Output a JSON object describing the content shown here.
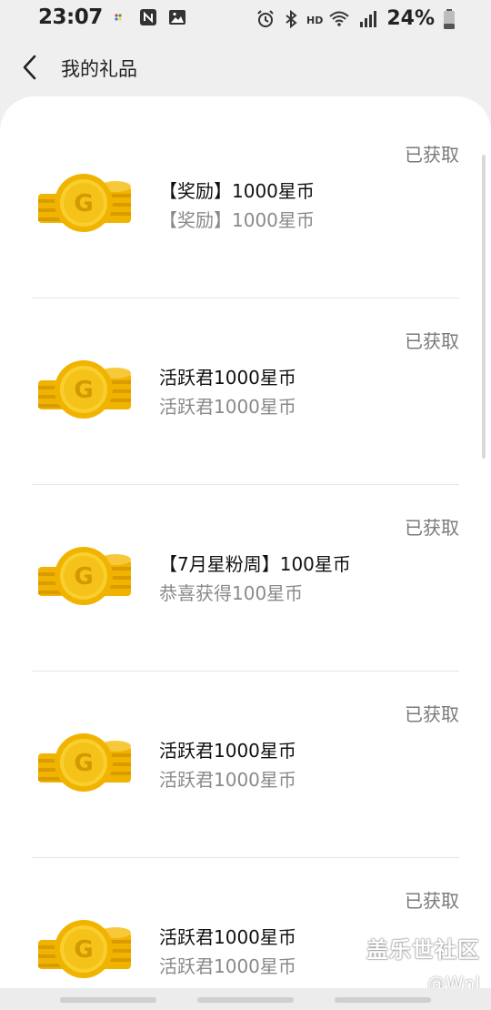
{
  "status_bar": {
    "time": "23:07",
    "hd": "HD",
    "battery": "24%",
    "icons_left": [
      "app-notification-icon",
      "nfc-icon",
      "image-icon"
    ],
    "icons_right": [
      "alarm-icon",
      "bluetooth-icon",
      "hd-icon",
      "wifi-4g-icon",
      "signal-icon",
      "battery-icon"
    ]
  },
  "header": {
    "title": "我的礼品"
  },
  "gifts": [
    {
      "name": "【奖励】1000星币",
      "desc": "【奖励】1000星币",
      "status": "已获取"
    },
    {
      "name": "活跃君1000星币",
      "desc": "活跃君1000星币",
      "status": "已获取"
    },
    {
      "name": "【7月星粉周】100星币",
      "desc": "恭喜获得100星币",
      "status": "已获取"
    },
    {
      "name": "活跃君1000星币",
      "desc": "活跃君1000星币",
      "status": "已获取"
    },
    {
      "name": "活跃君1000星币",
      "desc": "活跃君1000星币",
      "status": "已获取"
    }
  ],
  "watermark": {
    "main": "盖乐世社区",
    "sub": "@Wnl"
  },
  "colors": {
    "coin_gold": "#f5c518",
    "coin_dark": "#e0a800",
    "page_bg": "#efefef",
    "card_bg": "#ffffff"
  }
}
